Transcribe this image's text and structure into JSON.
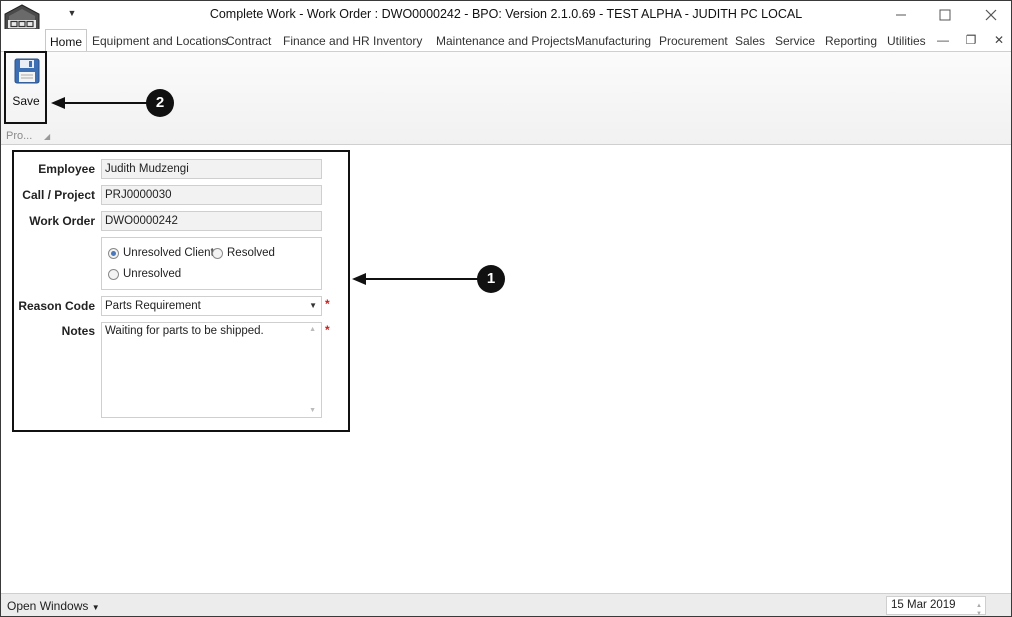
{
  "window": {
    "title": "Complete Work - Work Order : DWO0000242 - BPO: Version 2.1.0.69 - TEST ALPHA - JUDITH PC LOCAL"
  },
  "ribbon": {
    "tabs": [
      "Home",
      "Equipment and Locations",
      "Contract",
      "Finance and HR",
      "Inventory",
      "Maintenance and Projects",
      "Manufacturing",
      "Procurement",
      "Sales",
      "Service",
      "Reporting",
      "Utilities"
    ],
    "active_tab": "Home",
    "group_label": "Pro...",
    "save_label": "Save"
  },
  "form": {
    "employee_label": "Employee",
    "employee_value": "Judith Mudzengi",
    "project_label": "Call / Project",
    "project_value": "PRJ0000030",
    "work_order_label": "Work Order",
    "work_order_value": "DWO0000242",
    "status_options": [
      "Unresolved Client",
      "Resolved",
      "Unresolved"
    ],
    "status_selected": "Unresolved Client",
    "reason_label": "Reason Code",
    "reason_value": "Parts Requirement",
    "notes_label": "Notes",
    "notes_value": "Waiting for parts to be shipped.",
    "required_marker": "*"
  },
  "callouts": {
    "one": "1",
    "two": "2"
  },
  "statusbar": {
    "open_windows": "Open Windows",
    "date": "15 Mar 2019"
  },
  "colors": {
    "accent": "#4a78b8",
    "required": "#d21b1b"
  }
}
